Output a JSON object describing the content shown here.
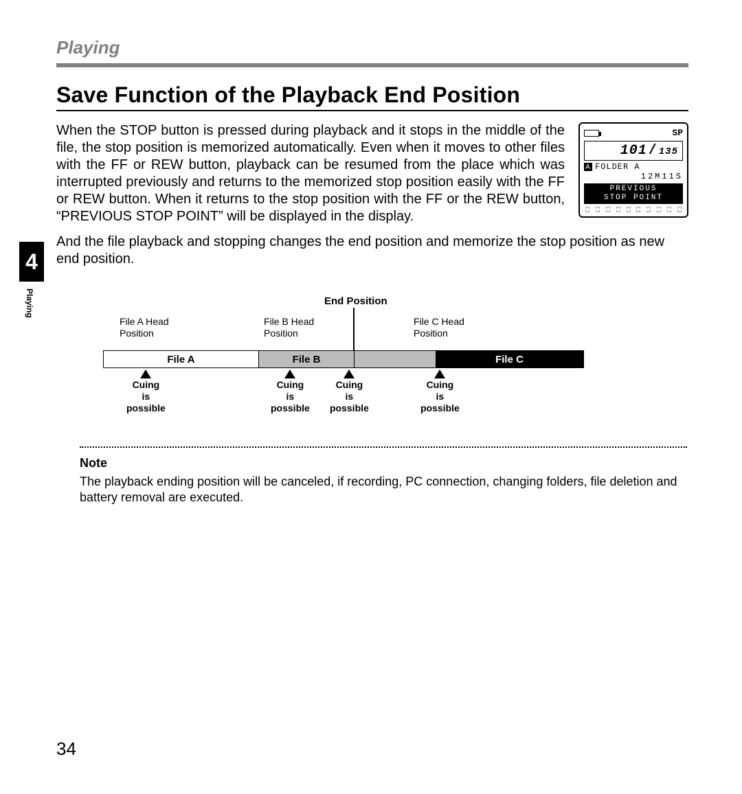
{
  "header": {
    "section": "Playing"
  },
  "chapter": {
    "number": "4",
    "side_label": "Playing"
  },
  "title": "Save Function of the Playback End Position",
  "body": {
    "para1": "When the STOP button is pressed during playback and it stops in the middle of the file, the stop position is memorized automatically. Even when it moves to other files with the FF or REW button, playback can be resumed from the place which was interrupted previously and returns to the memorized stop position easily with the FF or REW button. When it returns to the stop position with the FF or the REW button, “PREVIOUS STOP POINT” will be displayed in the display.",
    "para2": "And the file playback and stopping changes the end position and memorize the stop position as new end position."
  },
  "device": {
    "mode": "SP",
    "counter_main": "101",
    "counter_total": "135",
    "folder": "FOLDER A",
    "folder_letter": "A",
    "time": "12M11S",
    "prev_line1": "PREVIOUS",
    "prev_line2": "STOP POINT"
  },
  "diagram": {
    "end_position": "End Position",
    "file_heads": {
      "a": "File A Head\nPosition",
      "b": "File B Head\nPosition",
      "c": "File C Head\nPosition"
    },
    "files": {
      "a": "File A",
      "b": "File B",
      "c": "File C"
    },
    "cuing": "Cuing\nis\npossible"
  },
  "note": {
    "title": "Note",
    "body": "The playback ending position will be canceled, if recording, PC connection, changing folders, file deletion and battery removal are executed."
  },
  "page_number": "34"
}
